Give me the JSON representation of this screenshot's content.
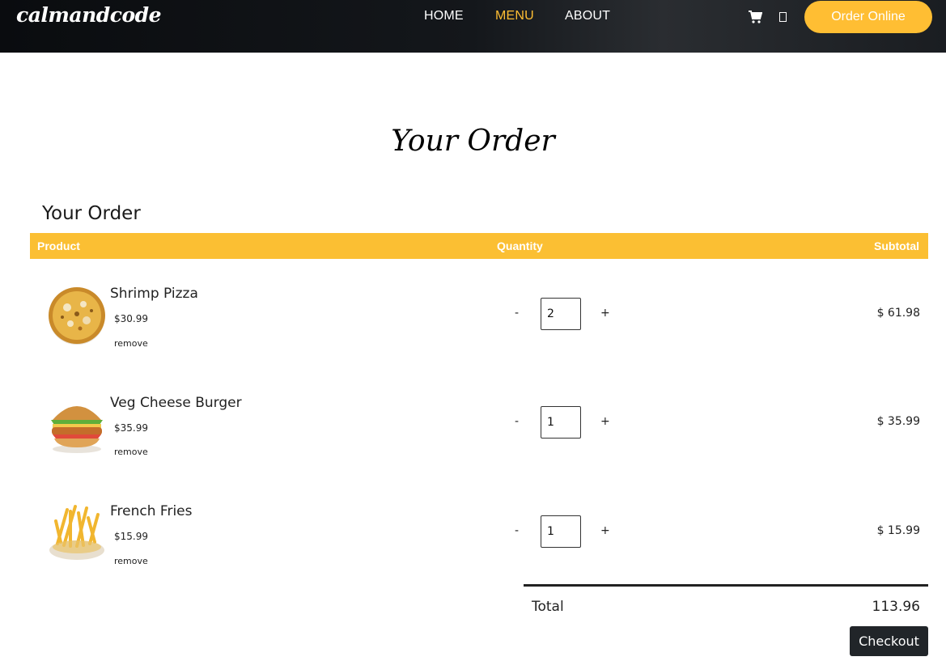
{
  "navbar": {
    "brand": "calmandcode",
    "links": [
      "HOME",
      "MENU",
      "ABOUT"
    ],
    "active_link": "MENU",
    "icons": [
      "cart-icon",
      "user-icon"
    ],
    "order_button": "Order Online",
    "accent_color": "#ffbe33"
  },
  "page": {
    "heading": "Your Order",
    "section_title": "Your Order"
  },
  "table": {
    "headers": {
      "product": "Product",
      "quantity": "Quantity",
      "subtotal": "Subtotal"
    },
    "header_color": "#fbbf33",
    "items": [
      {
        "name": "Shrimp Pizza",
        "price": "$30.99",
        "remove_label": "remove",
        "minus": "-",
        "plus": "+",
        "quantity": "2",
        "subtotal": "$ 61.98",
        "image": "pizza-image"
      },
      {
        "name": "Veg Cheese Burger",
        "price": "$35.99",
        "remove_label": "remove",
        "minus": "-",
        "plus": "+",
        "quantity": "1",
        "subtotal": "$ 35.99",
        "image": "burger-image"
      },
      {
        "name": "French Fries",
        "price": "$15.99",
        "remove_label": "remove",
        "minus": "-",
        "plus": "+",
        "quantity": "1",
        "subtotal": "$ 15.99",
        "image": "fries-image"
      }
    ]
  },
  "summary": {
    "total_label": "Total",
    "total_value": "113.96",
    "checkout_label": "Checkout"
  }
}
